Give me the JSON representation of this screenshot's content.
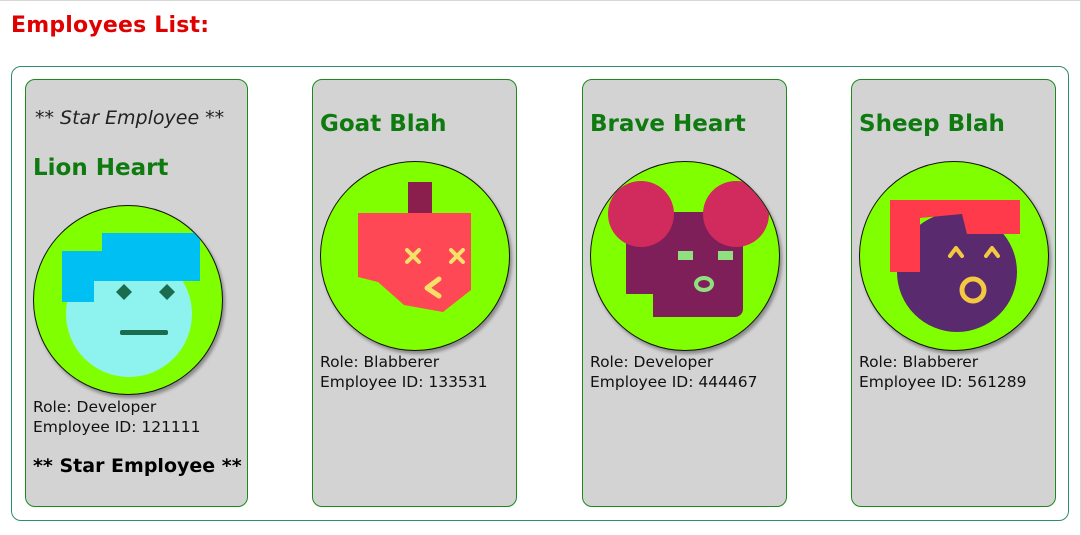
{
  "page": {
    "title": "Employees List:"
  },
  "colors": {
    "title": "#e00000",
    "name": "#0f7a0f",
    "card_background": "#d3d3d3",
    "avatar_background": "#7fff00"
  },
  "employees": [
    {
      "star_banner_top": "** Star Employee **",
      "name": "Lion Heart",
      "role_line": "Role: Developer",
      "id_line": "Employee ID: 121111",
      "star_banner_bottom": "** Star Employee **",
      "avatar_icon": "lion-avatar-icon"
    },
    {
      "name": "Goat Blah",
      "role_line": "Role: Blabberer",
      "id_line": "Employee ID: 133531",
      "avatar_icon": "goat-avatar-icon"
    },
    {
      "name": "Brave Heart",
      "role_line": "Role: Developer",
      "id_line": "Employee ID: 444467",
      "avatar_icon": "brave-avatar-icon"
    },
    {
      "name": "Sheep Blah",
      "role_line": "Role: Blabberer",
      "id_line": "Employee ID: 561289",
      "avatar_icon": "sheep-avatar-icon"
    }
  ]
}
